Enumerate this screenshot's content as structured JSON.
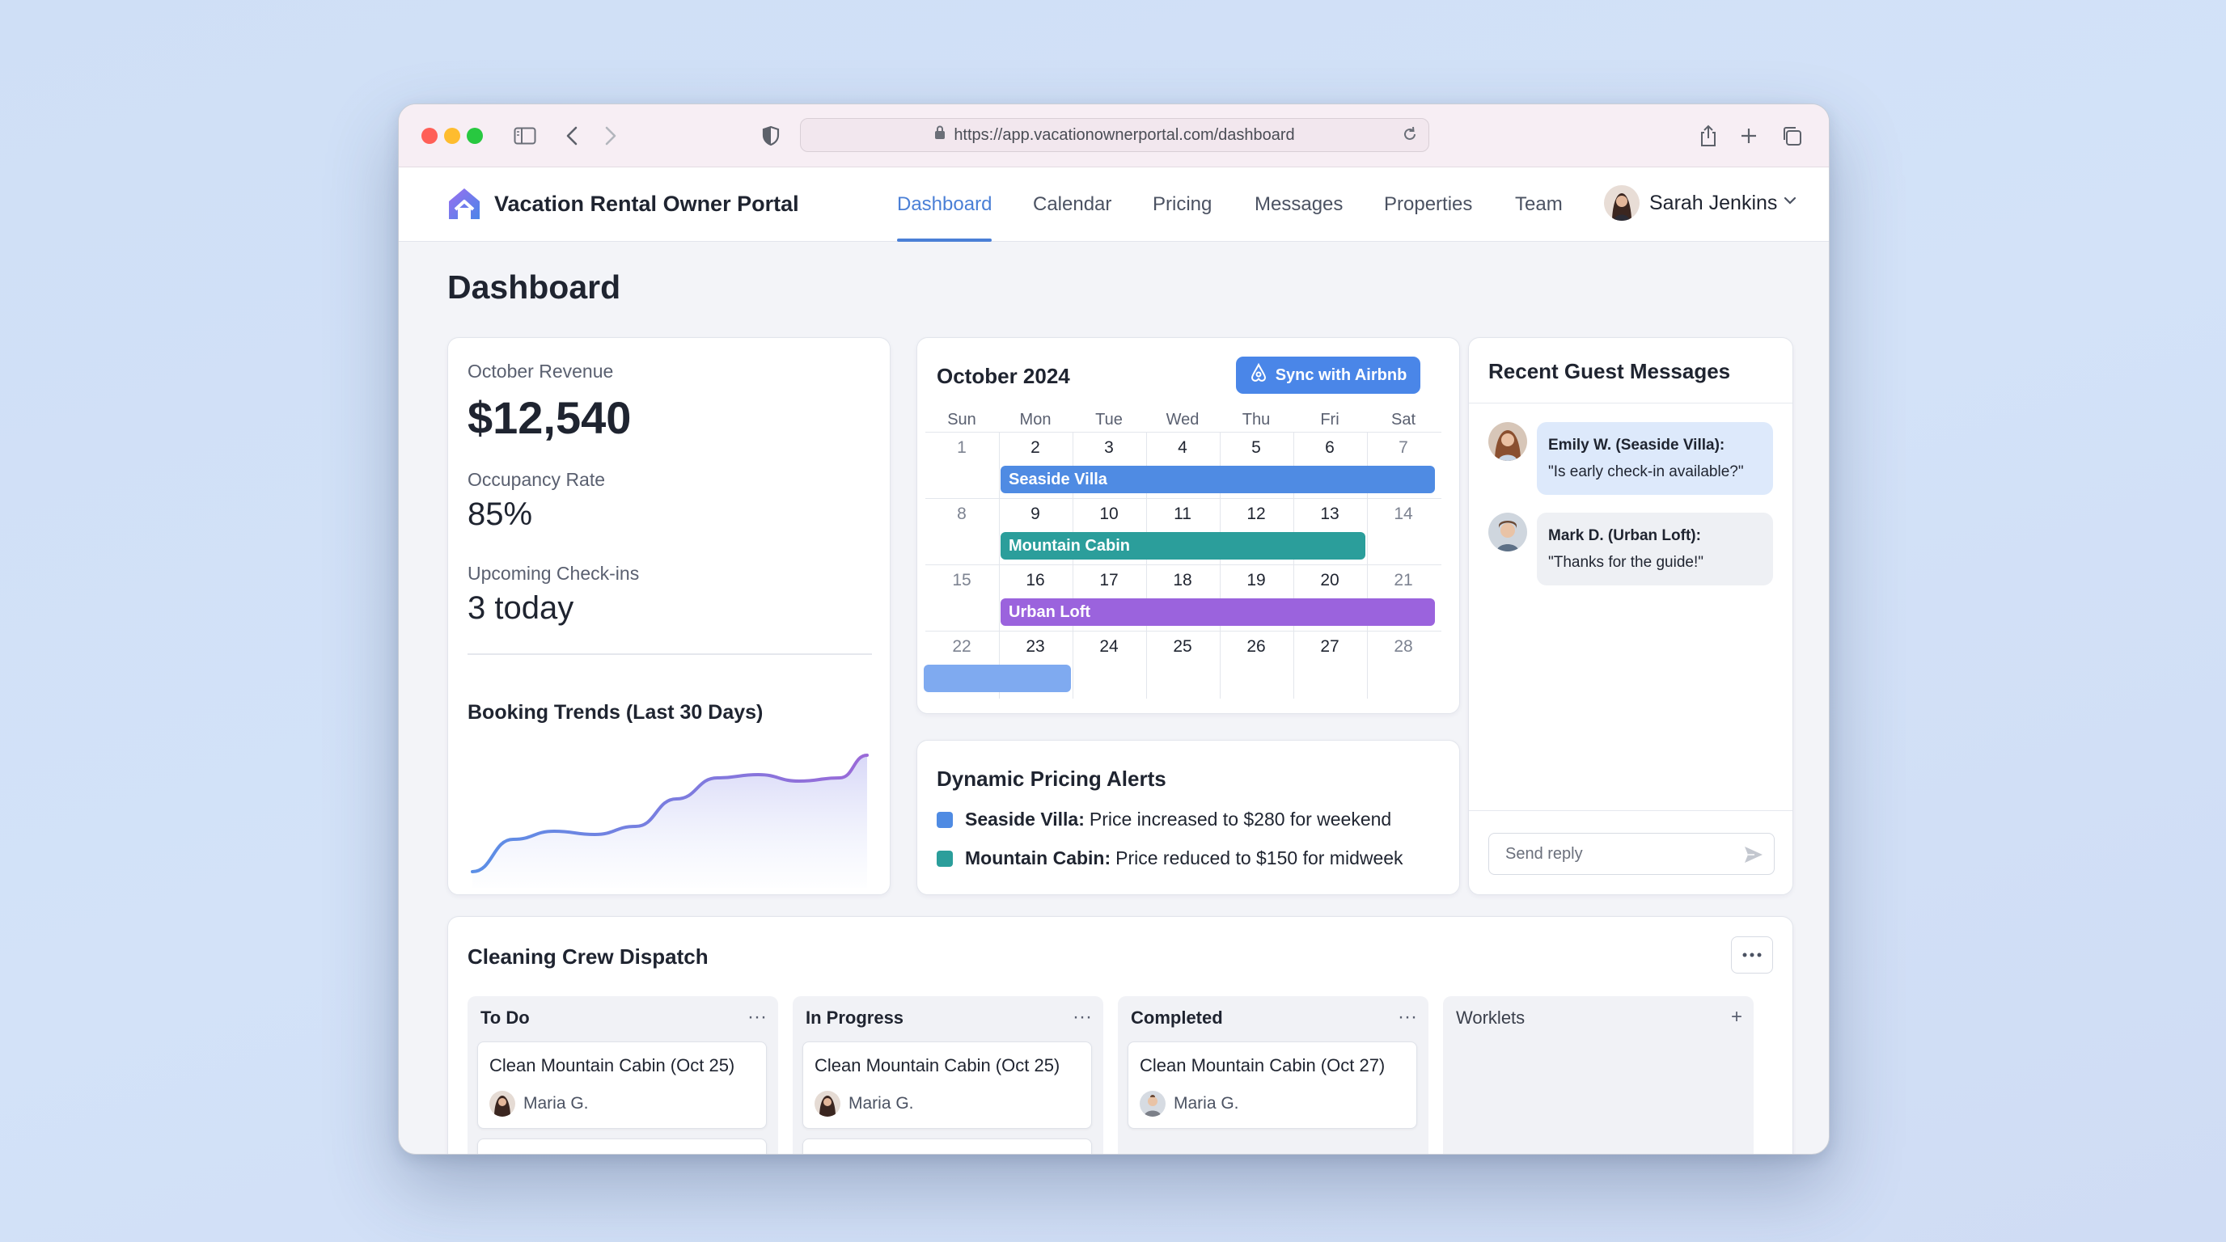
{
  "browser": {
    "url": "https://app.vacationownerportal.com/dashboard"
  },
  "app": {
    "title": "Vacation Rental Owner Portal",
    "nav": [
      "Dashboard",
      "Calendar",
      "Pricing",
      "Messages",
      "Properties",
      "Team"
    ],
    "active_nav": "Dashboard",
    "user_name": "Sarah Jenkins"
  },
  "page_title": "Dashboard",
  "stats": {
    "revenue_label": "October Revenue",
    "revenue_value": "$12,540",
    "occupancy_label": "Occupancy Rate",
    "occupancy_value": "85%",
    "checkins_label": "Upcoming Check-ins",
    "checkins_value": "3 today"
  },
  "chart_data": {
    "type": "area",
    "title": "Booking Trends (Last 30 Days)",
    "xlabel": "",
    "ylabel": "",
    "x": [
      1,
      4,
      7,
      10,
      13,
      16,
      19,
      22,
      25,
      28,
      30
    ],
    "values": [
      10,
      30,
      35,
      33,
      38,
      55,
      68,
      70,
      66,
      68,
      82
    ],
    "ylim": [
      0,
      100
    ],
    "grid": false,
    "colors": [
      "#5b8fe6",
      "#9a6ad8"
    ]
  },
  "calendar": {
    "title": "October 2024",
    "sync_label": "Sync with Airbnb",
    "weekdays": [
      "Sun",
      "Mon",
      "Tue",
      "Wed",
      "Thu",
      "Fri",
      "Sat"
    ],
    "weeks": [
      [
        "1",
        "2",
        "3",
        "4",
        "5",
        "6",
        "7"
      ],
      [
        "8",
        "9",
        "10",
        "11",
        "12",
        "13",
        "14"
      ],
      [
        "15",
        "16",
        "17",
        "18",
        "19",
        "20",
        "21"
      ],
      [
        "22",
        "23",
        "24",
        "25",
        "26",
        "27",
        "28"
      ]
    ],
    "bookings": [
      {
        "label": "Seaside Villa",
        "color": "#4f8be3"
      },
      {
        "label": "Mountain Cabin",
        "color": "#2b9e9b"
      },
      {
        "label": "Urban Loft",
        "color": "#9b63dd"
      },
      {
        "label": "",
        "color": "#7faaf0"
      }
    ]
  },
  "pricing_alerts": {
    "title": "Dynamic Pricing Alerts",
    "items": [
      {
        "property": "Seaside Villa:",
        "text": "Price increased to $280 for weekend",
        "color": "#4f8be3"
      },
      {
        "property": "Mountain Cabin:",
        "text": "Price reduced to $150 for midweek",
        "color": "#2b9e9b"
      }
    ]
  },
  "messages": {
    "title": "Recent Guest Messages",
    "items": [
      {
        "sender": "Emily W. (Seaside Villa):",
        "text": "\"Is early check-in available?\"",
        "bubble_color": "#dde9fb"
      },
      {
        "sender": "Mark D. (Urban Loft):",
        "text": "\"Thanks for the guide!\"",
        "bubble_color": "#eef0f4"
      }
    ],
    "reply_placeholder": "Send reply"
  },
  "cleaning": {
    "title": "Cleaning Crew Dispatch",
    "columns": [
      {
        "title": "To Do",
        "action": "···",
        "tasks": [
          {
            "title": "Clean Mountain Cabin (Oct 25)",
            "assignee": "Maria G."
          }
        ]
      },
      {
        "title": "In Progress",
        "action": "···",
        "tasks": [
          {
            "title": "Clean Mountain Cabin (Oct 25)",
            "assignee": "Maria G."
          }
        ]
      },
      {
        "title": "Completed",
        "action": "···",
        "tasks": [
          {
            "title": "Clean Mountain Cabin (Oct 27)",
            "assignee": "Maria G."
          }
        ]
      },
      {
        "title": "Worklets",
        "action": "+",
        "tasks": []
      }
    ]
  }
}
